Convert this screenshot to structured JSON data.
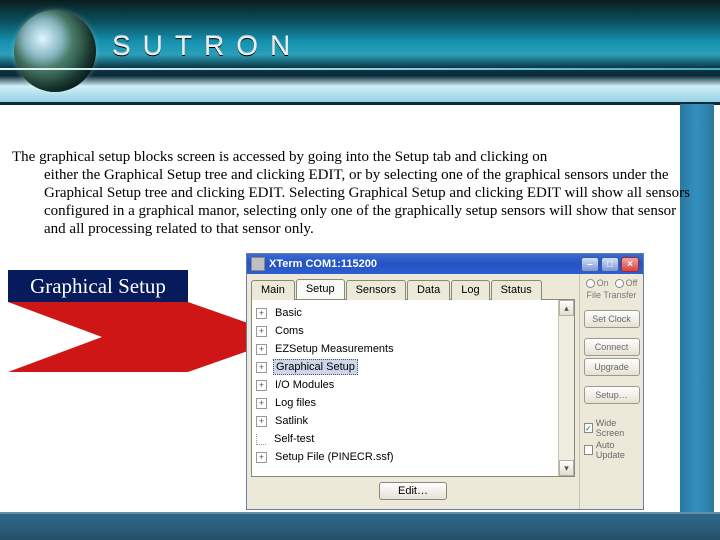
{
  "brand": "SUTRON",
  "paragraph_line1": "The graphical setup blocks screen is accessed by going into the Setup tab and clicking on",
  "paragraph_rest": "either the Graphical Setup tree and clicking EDIT, or by selecting one of the graphical sensors under the Graphical Setup tree and clicking EDIT. Selecting Graphical Setup and clicking EDIT will show all sensors configured in a graphical manor, selecting only one of the graphically setup sensors will show that sensor and all processing related to that sensor only.",
  "callout_label": "Graphical Setup",
  "xterm": {
    "title": "XTerm COM1:115200",
    "tabs": [
      "Main",
      "Setup",
      "Sensors",
      "Data",
      "Log",
      "Status"
    ],
    "active_tab": 1,
    "tree": [
      {
        "label": "Basic",
        "expandable": true
      },
      {
        "label": "Coms",
        "expandable": true
      },
      {
        "label": "EZSetup Measurements",
        "expandable": true
      },
      {
        "label": "Graphical Setup",
        "expandable": true,
        "selected": true
      },
      {
        "label": "I/O Modules",
        "expandable": true
      },
      {
        "label": "Log files",
        "expandable": true
      },
      {
        "label": "Satlink",
        "expandable": true
      },
      {
        "label": "Self-test",
        "expandable": false
      },
      {
        "label": "Setup File (PINECR.ssf)",
        "expandable": true
      }
    ],
    "edit_label": "Edit…",
    "right": {
      "radios": [
        "On",
        "Off"
      ],
      "file_transfer": "File Transfer",
      "buttons": [
        "Set Clock",
        "Connect",
        "Upgrade",
        "Setup…"
      ],
      "checkboxes": [
        {
          "label": "Wide Screen",
          "checked": true
        },
        {
          "label": "Auto Update",
          "checked": false
        }
      ]
    }
  }
}
